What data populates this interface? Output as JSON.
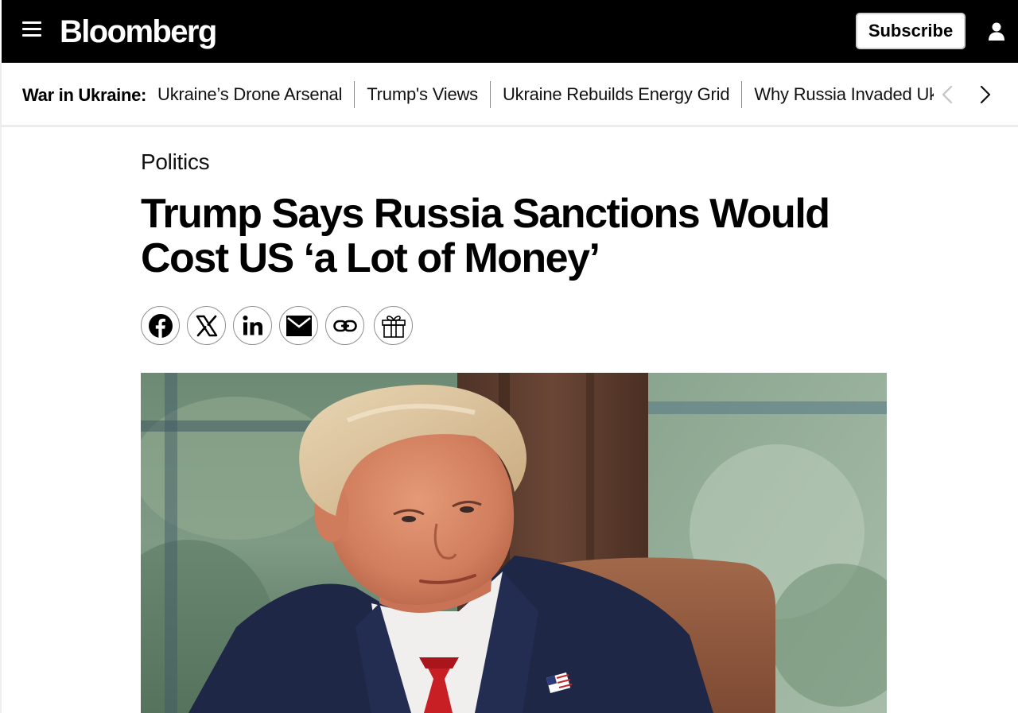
{
  "header": {
    "logo_text": "Bloomberg",
    "subscribe_label": "Subscribe",
    "background": "#000000"
  },
  "topic_nav": {
    "label": "War in Ukraine:",
    "links": [
      "Ukraine’s Drone Arsenal",
      "Trump's Views",
      "Ukraine Rebuilds Energy Grid",
      "Why Russia Invaded Ukraine"
    ]
  },
  "article": {
    "kicker": "Politics",
    "headline_line1": "Trump Says Russia Sanctions Would",
    "headline_line2": "Cost US ‘a Lot of Money’"
  },
  "share": {
    "buttons": [
      "facebook-icon",
      "x-icon",
      "linkedin-icon",
      "email-icon",
      "link-icon",
      "gift-icon"
    ]
  },
  "icons": {
    "menu": "menu-icon",
    "user": "user-icon",
    "prev": "chevron-left-icon",
    "next": "chevron-right-icon"
  }
}
